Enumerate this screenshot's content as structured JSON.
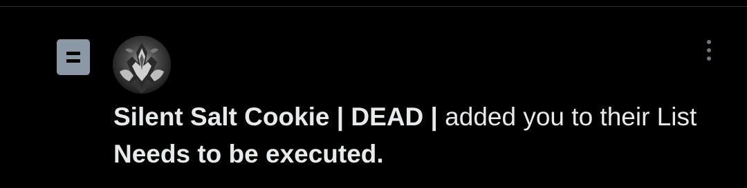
{
  "notification": {
    "user_display_name": "Silent Salt Cookie | DEAD |",
    "action_text": " added you to their List ",
    "list_name": "Needs to be executed.",
    "icon": "list-icon",
    "more_icon": "more-vertical-icon"
  },
  "colors": {
    "background": "#000000",
    "text": "#e7e9ea",
    "icon_gray": "#8b98a5",
    "muted": "#71767b"
  }
}
